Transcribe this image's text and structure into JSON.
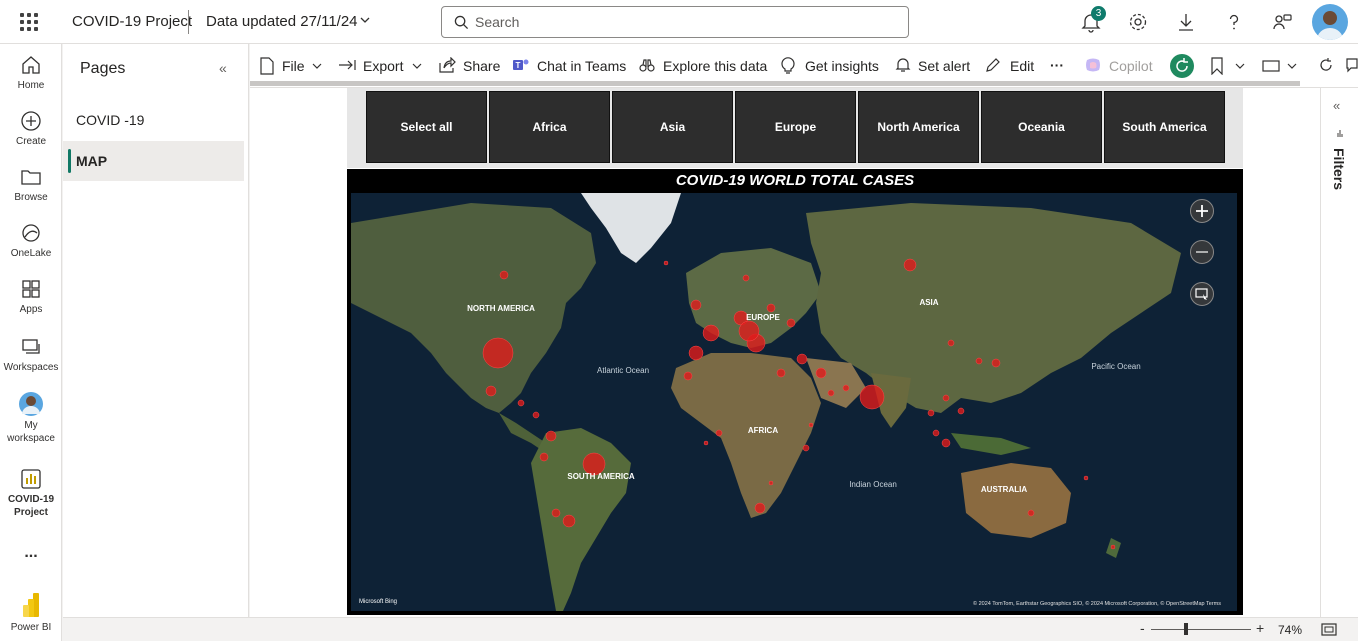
{
  "app": {
    "title": "COVID-19 Project",
    "data_updated": "Data updated 27/11/24",
    "notification_count": "3"
  },
  "search": {
    "placeholder": "Search"
  },
  "rail": {
    "items": [
      {
        "label": "Home",
        "icon": "home-icon"
      },
      {
        "label": "Create",
        "icon": "plus-circle-icon"
      },
      {
        "label": "Browse",
        "icon": "folder-icon"
      },
      {
        "label": "OneLake",
        "icon": "onelake-icon"
      },
      {
        "label": "Apps",
        "icon": "apps-icon"
      },
      {
        "label": "Workspaces",
        "icon": "workspaces-icon"
      },
      {
        "label": "My workspace",
        "icon": "avatar"
      },
      {
        "label": "COVID-19 Project",
        "icon": "report-icon"
      },
      {
        "label": "...",
        "icon": "more-icon"
      },
      {
        "label": "Power BI",
        "icon": "powerbi-logo"
      }
    ]
  },
  "pages": {
    "title": "Pages",
    "items": [
      {
        "label": "COVID -19",
        "active": false
      },
      {
        "label": "MAP",
        "active": true
      }
    ]
  },
  "actions": {
    "file": "File",
    "export": "Export",
    "share": "Share",
    "chat": "Chat in Teams",
    "explore": "Explore this data",
    "insights": "Get insights",
    "alert": "Set alert",
    "edit": "Edit",
    "more": "···",
    "copilot": "Copilot"
  },
  "slicer": {
    "options": [
      "Select all",
      "Africa",
      "Asia",
      "Europe",
      "North America",
      "Oceania",
      "South America"
    ]
  },
  "map": {
    "title": "COVID-19 WORLD TOTAL CASES",
    "labels": {
      "north_america": "NORTH AMERICA",
      "south_america": "SOUTH AMERICA",
      "europe": "EUROPE",
      "asia": "ASIA",
      "africa": "AFRICA",
      "australia": "AUSTRALIA",
      "atlantic": "Atlantic Ocean",
      "pacific": "Pacific Ocean",
      "indian": "Indian Ocean"
    },
    "attribution": "© 2024 TomTom, Earthstar Geographics SIO, © 2024 Microsoft Corporation, © OpenStreetMap  Terms",
    "bing": "Microsoft Bing",
    "bubble_color": "#e01b1b"
  },
  "filters": {
    "label": "Filters"
  },
  "status": {
    "zoom": "74%"
  },
  "colors": {
    "accent": "#117865",
    "slicer_bg": "#2d2d2d"
  }
}
